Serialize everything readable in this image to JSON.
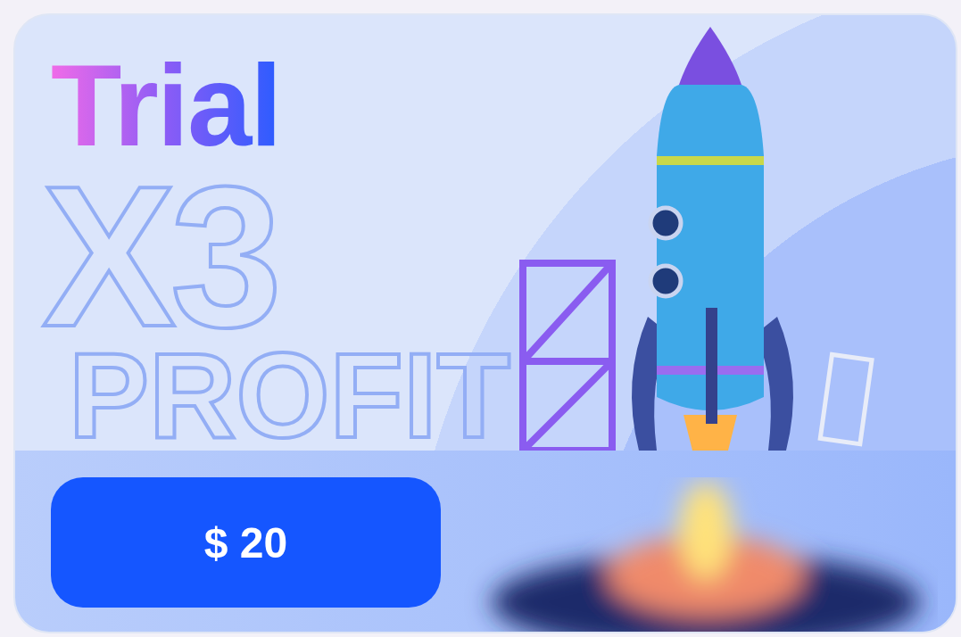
{
  "card": {
    "title": "Trial",
    "multiplier": "X3",
    "subtitle": "PROFIT",
    "price_button": "$ 20"
  }
}
